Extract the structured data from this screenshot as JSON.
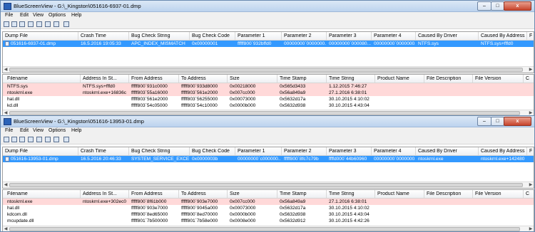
{
  "windows": [
    {
      "title": "BlueScreenView - G:\\_Kingston\\051616-6937-01.dmp",
      "menu": [
        "File",
        "Edit",
        "View",
        "Options",
        "Help"
      ],
      "dump_columns": [
        "Dump File",
        "Crash Time",
        "Bug Check String",
        "Bug Check Code",
        "Parameter 1",
        "Parameter 2",
        "Parameter 3",
        "Parameter 4",
        "Caused By Driver",
        "Caused By Address",
        "Fil"
      ],
      "dump_rows": [
        [
          "051616-6937-01.dmp",
          "16.5.2016 19:05:33",
          "APC_INDEX_MISMATCH",
          "0x00000001",
          "fffff800`932bffd0",
          "00000000`0000000...",
          "00000000`000080...",
          "00000000`0000000...",
          "NTFS.sys",
          "NTFS.sys+fffd0",
          ""
        ]
      ],
      "module_columns": [
        "Filename",
        "Address In St...",
        "From Address",
        "To Address",
        "Size",
        "Time Stamp",
        "Time String",
        "Product Name",
        "File Description",
        "File Version",
        "C"
      ],
      "module_rows": [
        [
          "NTFS.sys",
          "NTFS.sys+fffd0",
          "fffff800`931c0000",
          "fffff800`933d8000",
          "0x00218000",
          "0x565d3433",
          "1.12.2015 7:46:27",
          "",
          "",
          "",
          ""
        ],
        [
          "ntoskrnl.exe",
          "ntoskrnl.exe+16836c",
          "fffff803`55a16000",
          "fffff803`561e2000",
          "0x007cc000",
          "0x56a849a9",
          "27.1.2016 6:38:01",
          "",
          "",
          "",
          ""
        ],
        [
          "hal.dll",
          "",
          "fffff803`561e2000",
          "fffff803`56255000",
          "0x00073000",
          "0x5632d17a",
          "30.10.2015 4:10:02",
          "",
          "",
          "",
          ""
        ],
        [
          "kd.dll",
          "",
          "fffff803`54c05000",
          "fffff803`54c10000",
          "0x0000b000",
          "0x5632d938",
          "30.10.2015 4:43:04",
          "",
          "",
          "",
          ""
        ]
      ]
    },
    {
      "title": "BlueScreenView - G:\\_Kingston\\051616-13953-01.dmp",
      "menu": [
        "File",
        "Edit",
        "View",
        "Options",
        "Help"
      ],
      "dump_columns": [
        "Dump File",
        "Crash Time",
        "Bug Check String",
        "Bug Check Code",
        "Parameter 1",
        "Parameter 2",
        "Parameter 3",
        "Parameter 4",
        "Caused By Driver",
        "Caused By Address",
        "File"
      ],
      "dump_rows": [
        [
          "051616-13953-01.dmp",
          "16.5.2016 20:46:33",
          "SYSTEM_SERVICE_EXCE...",
          "0x0000003b",
          "00000000`c000000...",
          "fffff800`8fc7c79b",
          "ffffd000`44b60960",
          "00000000`0000000...",
          "ntoskrnl.exe",
          "ntoskrnl.exe+142480",
          ""
        ]
      ],
      "module_columns": [
        "Filename",
        "Address In St...",
        "From Address",
        "To Address",
        "Size",
        "Time Stamp",
        "Time String",
        "Product Name",
        "File Description",
        "File Version",
        "C"
      ],
      "module_rows": [
        [
          "ntoskrnl.exe",
          "ntoskrnl.exe+302ec0",
          "fffff800`8f61b000",
          "fffff800`903e7000",
          "0x007cc000",
          "0x56a849a9",
          "27.1.2016 6:38:01",
          "",
          "",
          "",
          ""
        ],
        [
          "hal.dll",
          "",
          "fffff800`903e7000",
          "fffff800`9045a000",
          "0x00073000",
          "0x5632d17a",
          "30.10.2015 4:10:02",
          "",
          "",
          "",
          ""
        ],
        [
          "kdcom.dll",
          "",
          "fffff800`8ed65000",
          "fffff800`8ed70000",
          "0x0000b000",
          "0x5632d938",
          "30.10.2015 4:43:04",
          "",
          "",
          "",
          ""
        ],
        [
          "mcupdate.dll",
          "",
          "fffff801`7b500000",
          "fffff801`7b58e000",
          "0x0008e000",
          "0x5632d912",
          "30.10.2015 4:42:26",
          "",
          "",
          "",
          ""
        ]
      ]
    }
  ],
  "caption_buttons": {
    "minimize": "–",
    "maximize": "□",
    "close": "x"
  },
  "colors": {
    "selection": "#3399ff",
    "highlight_row": "#ffd9d9",
    "titlebar": "#c9dcf2"
  }
}
